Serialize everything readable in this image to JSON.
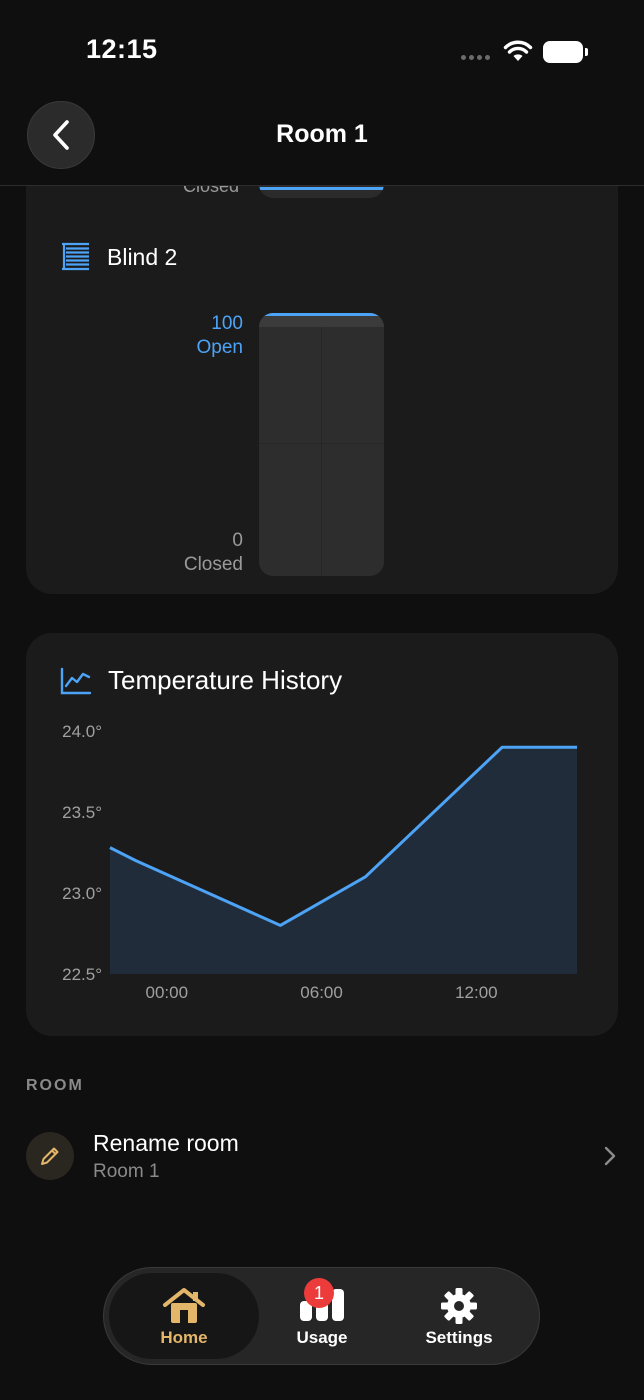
{
  "status_bar": {
    "time": "12:15"
  },
  "nav": {
    "title": "Room 1"
  },
  "blinds": {
    "previous_closed_label": "Closed",
    "blind2": {
      "name": "Blind 2",
      "max_value": "100",
      "max_label": "Open",
      "min_value": "0",
      "min_label": "Closed",
      "position_percent": 100
    }
  },
  "temperature": {
    "title": "Temperature History",
    "chart_data": {
      "type": "area",
      "title": "Temperature History",
      "xlabel": "",
      "ylabel": "",
      "y_ticks": [
        "24.0°",
        "23.5°",
        "23.0°",
        "22.5°"
      ],
      "x_ticks": [
        "00:00",
        "06:00",
        "12:00"
      ],
      "ylim": [
        22.5,
        24.0
      ],
      "xlim_hours": [
        -2.2,
        15.9
      ],
      "series": [
        {
          "points": [
            [
              -2.2,
              23.28
            ],
            [
              -1.2,
              23.2
            ],
            [
              4.4,
              22.8
            ],
            [
              7.7,
              23.1
            ],
            [
              13.0,
              23.9
            ],
            [
              15.9,
              23.9
            ]
          ]
        }
      ],
      "grid": false,
      "colors": {
        "line": "#4da3f5",
        "fill": "#212c3a"
      }
    }
  },
  "room_section": {
    "label": "ROOM",
    "rename": {
      "title": "Rename room",
      "subtitle": "Room 1"
    }
  },
  "tabbar": {
    "home": "Home",
    "usage": "Usage",
    "usage_badge": "1",
    "settings": "Settings"
  },
  "colors": {
    "accent": "#4da3f5",
    "gold": "#e3b66a",
    "badge": "#ec3b3b"
  }
}
